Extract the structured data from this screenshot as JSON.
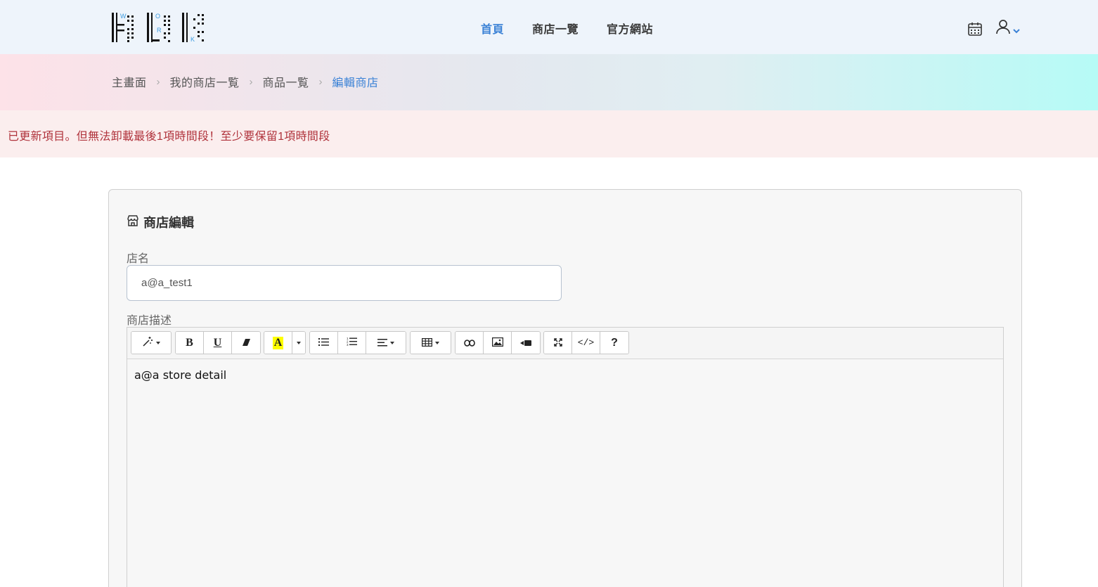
{
  "nav": {
    "logo_letters": [
      "W",
      "O",
      "R",
      "K"
    ],
    "links": [
      {
        "label": "首頁"
      },
      {
        "label": "商店一覽"
      },
      {
        "label": "官方網站"
      }
    ],
    "icons": [
      "calendar-icon",
      "user-icon",
      "chevron-down-icon"
    ],
    "accent_color": "#3b82d6"
  },
  "breadcrumb": {
    "items": [
      "主畫面",
      "我的商店一覧",
      "商品一覧",
      "編輯商店"
    ],
    "separator": "›"
  },
  "alert": {
    "message": "已更新項目。但無法卸載最後1項時間段！至少要保留1項時間段",
    "color": "#b0333c"
  },
  "form": {
    "title": "商店編輯",
    "name_label": "店名",
    "name_value": "a@a_test1",
    "description_label": "商店描述",
    "description_value": "a@a store detail"
  },
  "toolbar": {
    "bold": "B",
    "underline": "U",
    "highlight": "A",
    "codeview": "</>",
    "help": "?"
  }
}
